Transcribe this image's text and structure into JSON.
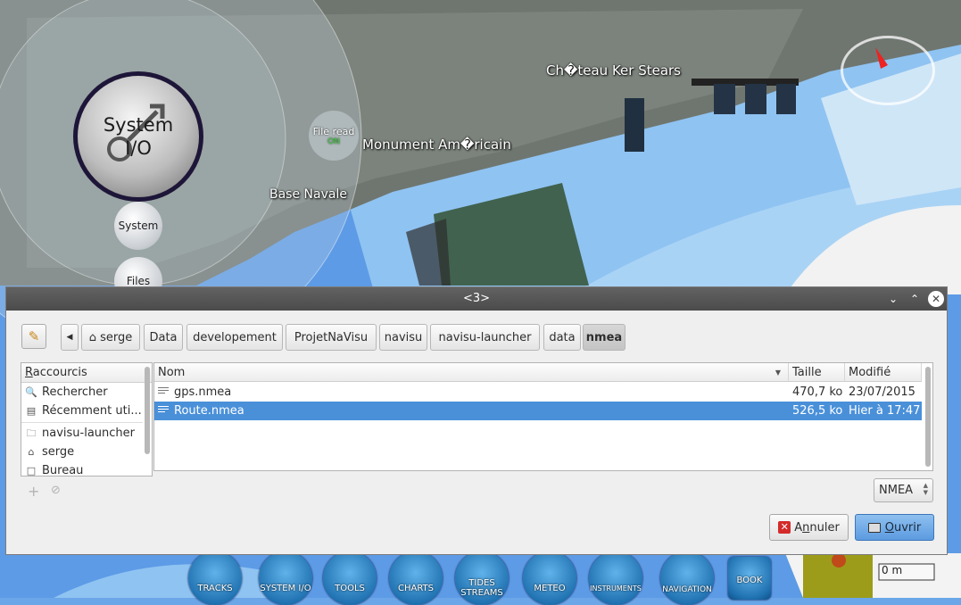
{
  "map": {
    "labels": {
      "chateau": "Ch�teau Ker Stears",
      "monument": "Monument Am�ricain",
      "base": "Base Navale"
    },
    "radial_menu": {
      "main_line1": "System",
      "main_line2": "I/O",
      "system": "System",
      "files": "Files",
      "file_read": "File read",
      "file_read_state": "ON"
    },
    "scale_text": "0 m"
  },
  "toolbar": {
    "tracks": "TRACKS",
    "system_io": "SYSTEM I/O",
    "tools": "TOOLS",
    "charts": "CHARTS",
    "tides": "TIDES STREAMS",
    "meteo": "METEO",
    "instruments": "INSTRUMENTS",
    "navigation": "NAVIGATION",
    "book": "BOOK"
  },
  "dialog": {
    "title": "<3>",
    "path": [
      "serge",
      "Data",
      "developement",
      "ProjetNaVisu",
      "navisu",
      "navisu-launcher",
      "data",
      "nmea"
    ],
    "places_header_first": "R",
    "places_header_rest": "accourcis",
    "places": [
      "Rechercher",
      "Récemment uti...",
      "navisu-launcher",
      "serge",
      "Bureau"
    ],
    "columns": {
      "name": "Nom",
      "size": "Taille",
      "modified": "Modifié"
    },
    "files": [
      {
        "name": "gps.nmea",
        "size": "470,7 ko",
        "modified": "23/07/2015"
      },
      {
        "name": "Route.nmea",
        "size": "526,5 ko",
        "modified": "Hier à 17:47"
      }
    ],
    "filter": "NMEA",
    "cancel_pre": "A",
    "cancel_u": "n",
    "cancel_post": "nuler",
    "open_u": "O",
    "open_post": "uvrir"
  },
  "colors": {
    "selection": "#4a90d9",
    "titlebar": "#555555",
    "sea": "#6aa6e8",
    "cancel_icon": "#d42a2a"
  }
}
